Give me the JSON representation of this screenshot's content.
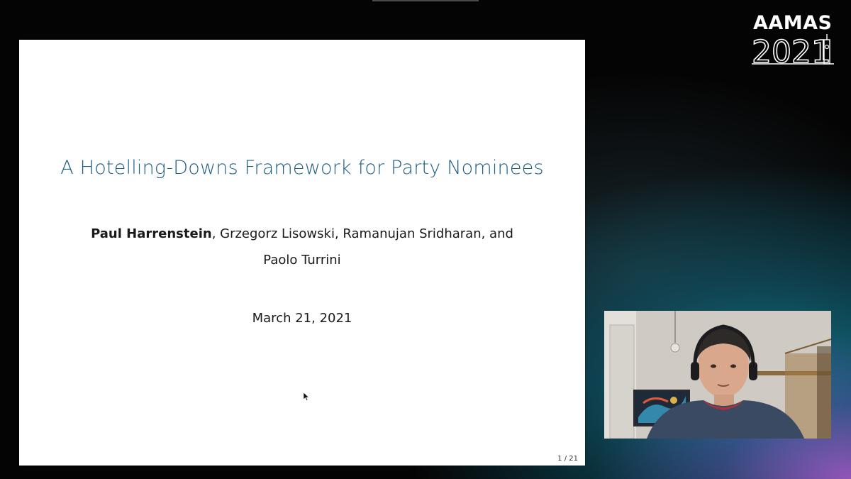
{
  "logo": {
    "text": "AAMAS",
    "year": "2021"
  },
  "slide": {
    "title": "A Hotelling-Downs Framework for Party Nominees",
    "presenter": "Paul Harrenstein",
    "coauthors_line1": ", Grzegorz Lisowski, Ramanujan Sridharan, and",
    "coauthors_line2": "Paolo Turrini",
    "date": "March 21, 2021",
    "page": "1 / 21",
    "title_color": "#1f5f86"
  },
  "webcam": {
    "subject": "presenter-video"
  }
}
